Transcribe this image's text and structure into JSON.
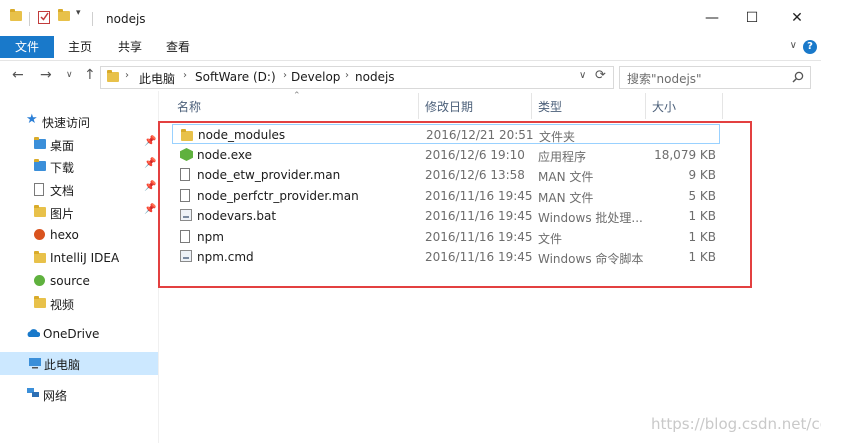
{
  "window": {
    "title": "nodejs"
  },
  "ribbon": {
    "tabs": [
      "文件",
      "主页",
      "共享",
      "查看"
    ]
  },
  "address": {
    "crumbs": [
      "此电脑",
      "SoftWare (D:)",
      "Develop",
      "nodejs"
    ],
    "search_placeholder": "搜索\"nodejs\""
  },
  "nav": {
    "quick_access": "快速访问",
    "items": [
      {
        "label": "桌面",
        "pinned": true
      },
      {
        "label": "下载",
        "pinned": true
      },
      {
        "label": "文档",
        "pinned": true
      },
      {
        "label": "图片",
        "pinned": true
      },
      {
        "label": "hexo",
        "pinned": false
      },
      {
        "label": "IntelliJ IDEA",
        "pinned": false
      },
      {
        "label": "source",
        "pinned": false
      },
      {
        "label": "视频",
        "pinned": false
      }
    ],
    "onedrive": "OneDrive",
    "this_pc": "此电脑",
    "network": "网络"
  },
  "columns": {
    "name": "名称",
    "date": "修改日期",
    "type": "类型",
    "size": "大小"
  },
  "files": [
    {
      "name": "node_modules",
      "date": "2016/12/21 20:51",
      "type": "文件夹",
      "size": "",
      "icon": "folder-icon"
    },
    {
      "name": "node.exe",
      "date": "2016/12/6 19:10",
      "type": "应用程序",
      "size": "18,079 KB",
      "icon": "node-exe-icon"
    },
    {
      "name": "node_etw_provider.man",
      "date": "2016/12/6 13:58",
      "type": "MAN 文件",
      "size": "9 KB",
      "icon": "file-icon"
    },
    {
      "name": "node_perfctr_provider.man",
      "date": "2016/11/16 19:45",
      "type": "MAN 文件",
      "size": "5 KB",
      "icon": "file-icon"
    },
    {
      "name": "nodevars.bat",
      "date": "2016/11/16 19:45",
      "type": "Windows 批处理...",
      "size": "1 KB",
      "icon": "batch-file-icon"
    },
    {
      "name": "npm",
      "date": "2016/11/16 19:45",
      "type": "文件",
      "size": "1 KB",
      "icon": "file-icon"
    },
    {
      "name": "npm.cmd",
      "date": "2016/11/16 19:45",
      "type": "Windows 命令脚本",
      "size": "1 KB",
      "icon": "batch-file-icon"
    }
  ],
  "watermark": "https://blog.csdn.net/cedricdx",
  "colors": {
    "accent": "#1979ca",
    "highlight": "#e34040",
    "selected": "#cce8ff"
  }
}
